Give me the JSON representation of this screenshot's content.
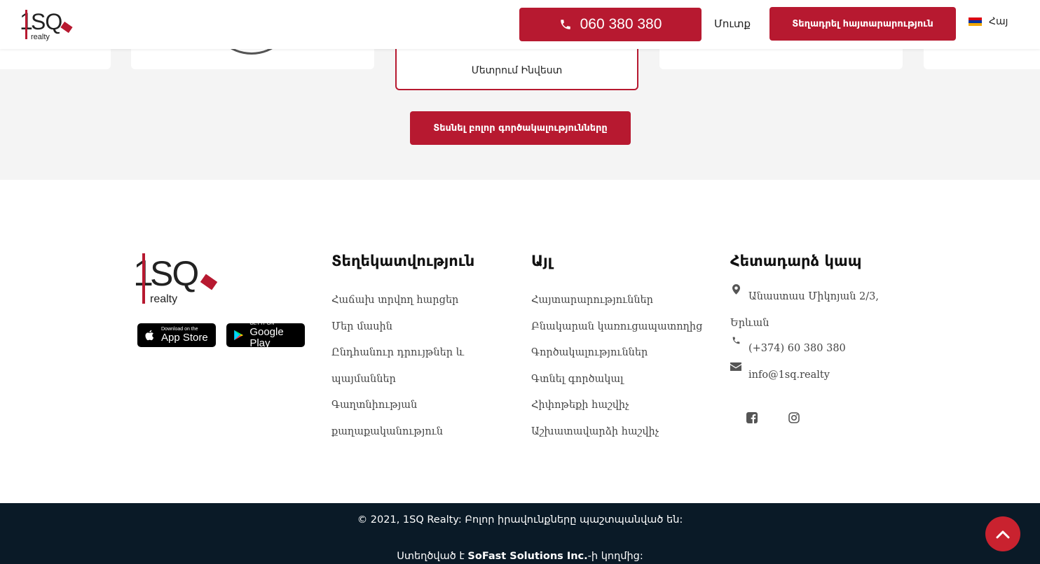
{
  "header": {
    "phone": "060 380 380",
    "login": "Մուտք",
    "post_ad": "Տեղադրել հայտարարություն",
    "language": "Հայ"
  },
  "agents": {
    "featured_name": "Մետրում Ինվեստ",
    "all_button": "Տեսնել բոլոր գործակալությունները"
  },
  "store": {
    "apple_small": "Download on the",
    "apple_big": "App Store",
    "google_small": "GET IT ON",
    "google_big": "Google Play"
  },
  "footer": {
    "info": {
      "title": "Տեղեկատվություն",
      "links": [
        "Հաճախ տրվող հարցեր",
        "Մեր մասին",
        "Ընդհանուր դրույթներ և",
        "պայմաններ",
        "Գաղտնիության",
        "քաղաքականություն"
      ]
    },
    "other": {
      "title": "Այլ",
      "links": [
        "Հայտարարություններ",
        "Բնակարան կառուցապատողից",
        "Գործակալություններ",
        "Գտնել գործակալ",
        "Հիփոթեքի հաշվիչ",
        "Աշխատավարձի հաշվիչ"
      ]
    },
    "contact": {
      "title": "Հետադարձ կապ",
      "address_line1": "Անաստաս Միկոյան 2/3,",
      "address_line2": "Երևան",
      "phone": "(+374) 60 380 380",
      "email": "info@1sq.realty"
    }
  },
  "bottom": {
    "copyright": "© 2021, 1SQ Realty: Բոլոր իրավունքները պաշտպանված են:",
    "made_prefix": "Ստեղծված է ",
    "made_company": "SoFast Solutions Inc.",
    "made_suffix": "-ի կողմից:"
  },
  "colors": {
    "brand_red": "#b71930",
    "footer_dark": "#0a1a27",
    "grey_bg": "#f4f4f4"
  },
  "icons": [
    "phone-icon",
    "flag-icon",
    "map-marker-icon",
    "phone-small-icon",
    "envelope-icon",
    "facebook-icon",
    "instagram-icon",
    "apple-icon",
    "google-play-icon",
    "chevron-up-icon"
  ]
}
